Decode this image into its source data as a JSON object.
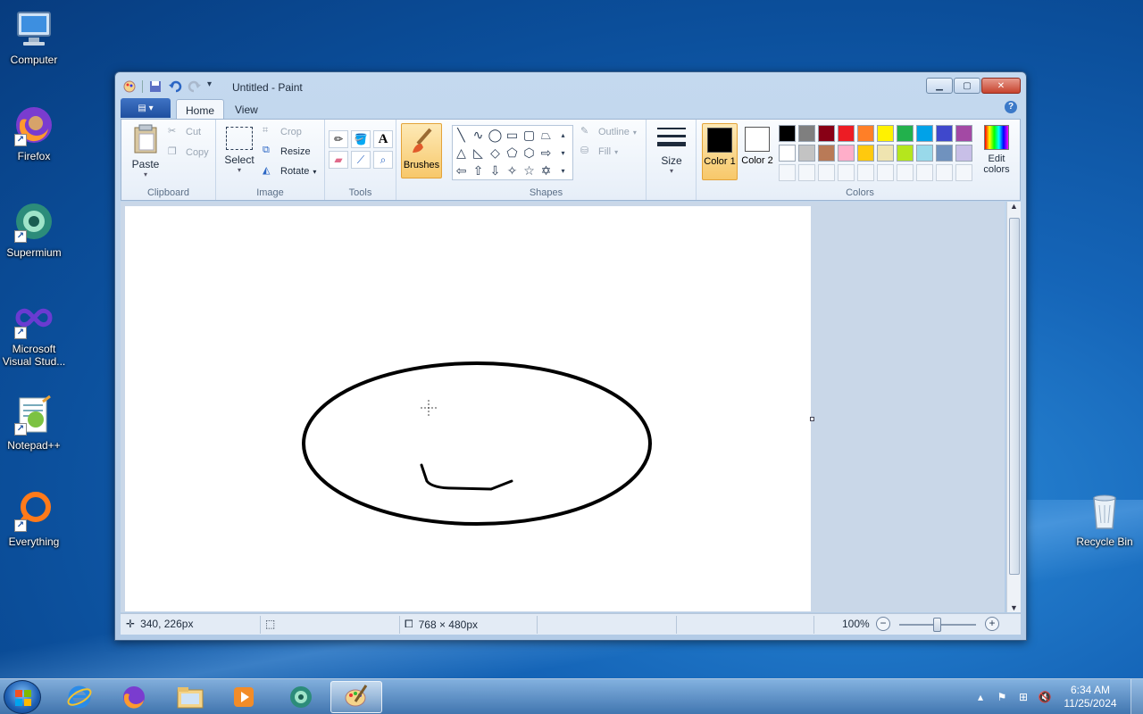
{
  "desktop": {
    "icons": [
      {
        "label": "Computer",
        "icon": "computer-icon"
      },
      {
        "label": "Firefox",
        "icon": "firefox-icon"
      },
      {
        "label": "Supermium",
        "icon": "supermium-icon"
      },
      {
        "label": "Microsoft Visual Stud...",
        "icon": "visual-studio-icon"
      },
      {
        "label": "Notepad++",
        "icon": "notepadpp-icon"
      },
      {
        "label": "Everything",
        "icon": "everything-icon"
      },
      {
        "label": "Recycle Bin",
        "icon": "recycle-bin-icon"
      }
    ]
  },
  "window": {
    "title": "Untitled - Paint",
    "tabs": [
      {
        "label": "Home"
      },
      {
        "label": "View"
      }
    ],
    "ribbon": {
      "clipboard": {
        "label": "Clipboard",
        "paste": "Paste",
        "cut": "Cut",
        "copy": "Copy"
      },
      "image": {
        "label": "Image",
        "select": "Select",
        "crop": "Crop",
        "resize": "Resize",
        "rotate": "Rotate"
      },
      "tools": {
        "label": "Tools"
      },
      "brushes": {
        "label": "Brushes"
      },
      "shapes": {
        "label": "Shapes",
        "outline": "Outline",
        "fill": "Fill"
      },
      "size": {
        "label": "Size"
      },
      "colors": {
        "label": "Colors",
        "color1": "Color 1",
        "color1_value": "#000000",
        "color2": "Color 2",
        "color2_value": "#ffffff",
        "edit_colors": "Edit colors",
        "palette_row1": [
          "#000000",
          "#7f7f7f",
          "#880015",
          "#ed1c24",
          "#ff7f27",
          "#fff200",
          "#22b14c",
          "#00a2e8",
          "#3f48cc",
          "#a349a4"
        ],
        "palette_row2": [
          "#ffffff",
          "#c3c3c3",
          "#b97a57",
          "#ffaec9",
          "#ffc90e",
          "#efe4b0",
          "#b5e61d",
          "#99d9ea",
          "#7092be",
          "#c8bfe7"
        ]
      }
    },
    "status": {
      "cursor_pos": "340, 226px",
      "canvas_size": "768 × 480px",
      "zoom": "100%",
      "zoom_level": 0.5
    }
  },
  "taskbar": {
    "items": [
      "internet-explorer-icon",
      "firefox-icon",
      "file-explorer-icon",
      "media-player-icon",
      "supermium-icon",
      "paint-icon"
    ],
    "clock_time": "6:34 AM",
    "clock_date": "11/25/2024"
  }
}
